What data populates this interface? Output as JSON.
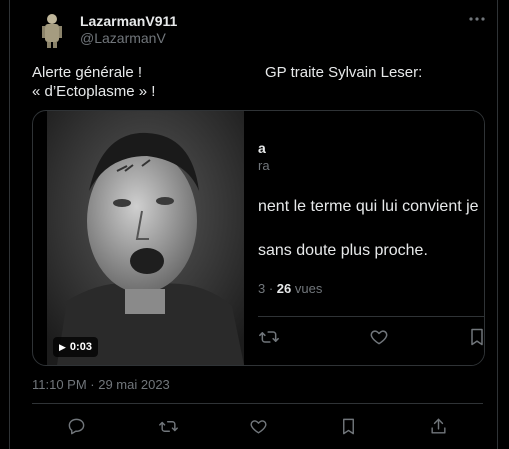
{
  "tweet": {
    "author": {
      "display_name": "LazarmanV911",
      "handle": "@LazarmanV"
    },
    "text_left": {
      "line1": "Alerte générale !",
      "line2": "« d’Ectoplasme » !"
    },
    "text_right": "GP traite Sylvain Leser:",
    "timestamp": "11:10 PM · 29 mai 2023"
  },
  "media": {
    "video_duration": "0:03",
    "quoted": {
      "name_fragment": "a",
      "handle_fragment": "ra",
      "line1": "nent le terme qui lui convient je",
      "line2": "sans doute plus proche.",
      "stats_prefix": "3 · ",
      "views_count": "26",
      "views_label": " vues"
    }
  },
  "colors": {
    "background": "#000000",
    "text": "#e7e9ea",
    "secondary": "#71767b",
    "border": "#2f3336"
  },
  "icons": [
    "more-icon",
    "play-icon",
    "reply-icon",
    "retweet-icon",
    "like-icon",
    "bookmark-icon",
    "share-icon"
  ]
}
